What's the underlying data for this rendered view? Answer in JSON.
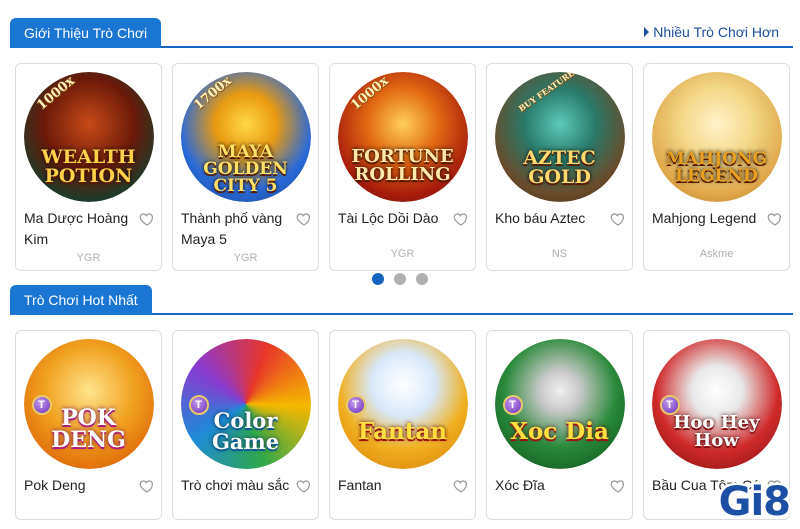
{
  "section1": {
    "title": "Giới Thiệu Trò Chơi",
    "more_link": "Nhiều Trò Chơi Hơn",
    "cards": [
      {
        "title": "Ma Dược Hoàng Kim",
        "provider": "YGR",
        "logo": "WEALTH POTION",
        "badge": "1000x"
      },
      {
        "title": "Thành phố vàng Maya 5",
        "provider": "YGR",
        "logo": "MAYA GOLDEN CITY 5",
        "badge": "1700x"
      },
      {
        "title": "Tài Lộc Dồi Dào",
        "provider": "YGR",
        "logo": "FORTUNE ROLLING",
        "badge": "1000x"
      },
      {
        "title": "Kho báu Aztec",
        "provider": "NS",
        "logo": "AZTEC GOLD",
        "badge": "BUY FEATURES"
      },
      {
        "title": "Mahjong Legend",
        "provider": "Askme",
        "logo": "MAHJONG LEGEND",
        "badge": ""
      }
    ],
    "pagination": {
      "pages": 3,
      "active": 0
    }
  },
  "section2": {
    "title": "Trò Chơi Hot Nhất",
    "cards": [
      {
        "title": "Pok Deng",
        "logo": "POK DENG"
      },
      {
        "title": "Trò chơi màu sắc",
        "logo": "Color Game"
      },
      {
        "title": "Fantan",
        "logo": "Fantan"
      },
      {
        "title": "Xóc Đĩa",
        "logo": "Xoc Dia"
      },
      {
        "title": "Bầu Cua Tôm Cá",
        "logo": "Hoo Hey How"
      }
    ]
  },
  "brand": {
    "logo": "Gi8"
  },
  "colors": {
    "accent": "#1976d2",
    "border": "#1565c0",
    "link": "#1e4fa0",
    "provider_text": "#b0b0b0"
  }
}
